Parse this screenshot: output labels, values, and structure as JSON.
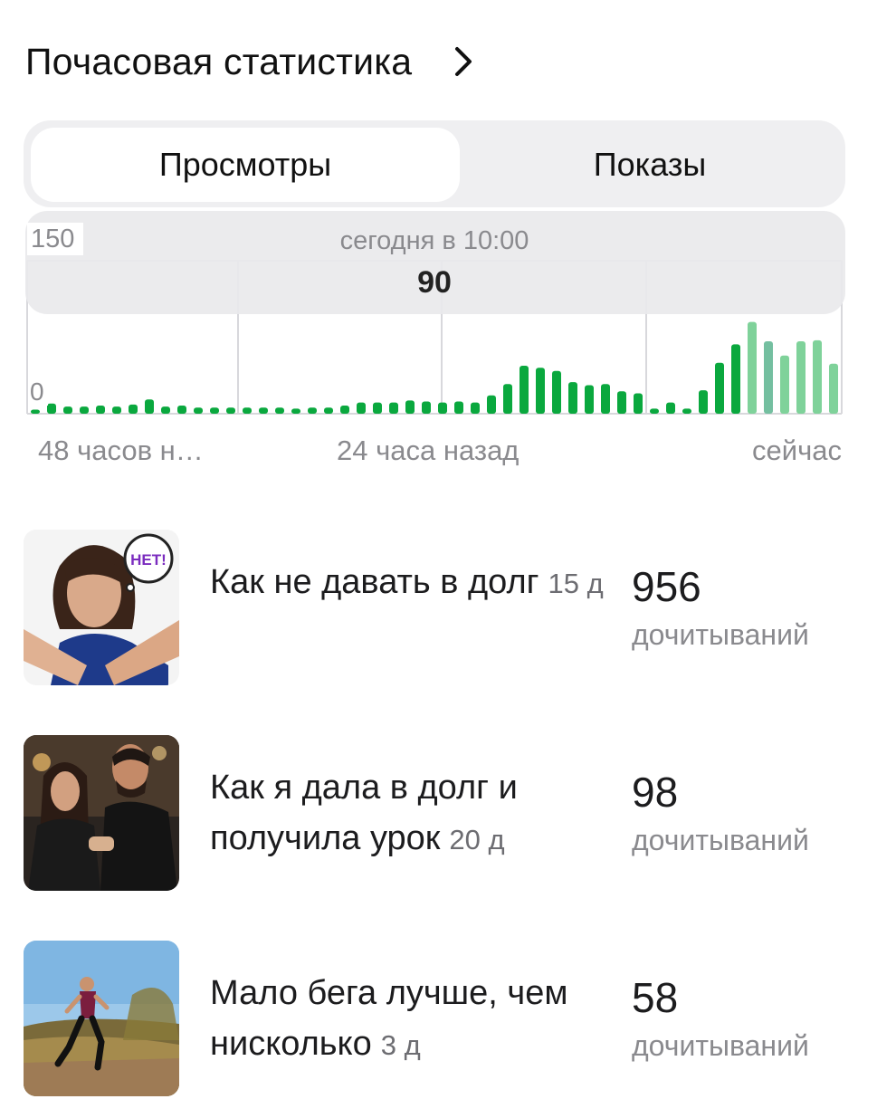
{
  "header": {
    "title": "Почасовая статистика"
  },
  "tabs": [
    {
      "label": "Просмотры",
      "active": true
    },
    {
      "label": "Показы",
      "active": false
    }
  ],
  "chart_data": {
    "type": "bar",
    "ymax_label": "150",
    "ymin_label": "0",
    "ylim": [
      0,
      150
    ],
    "tooltip": {
      "time": "сегодня в 10:00",
      "value": "90"
    },
    "x_labels": [
      "48 часов н…",
      "24 часа назад",
      "сейчас"
    ],
    "values": [
      4,
      10,
      7,
      7,
      8,
      7,
      9,
      14,
      7,
      8,
      6,
      6,
      6,
      6,
      6,
      6,
      5,
      6,
      6,
      8,
      11,
      11,
      11,
      13,
      12,
      11,
      12,
      11,
      18,
      29,
      47,
      45,
      42,
      31,
      28,
      29,
      22,
      20,
      5,
      11,
      5,
      23,
      50,
      68,
      90,
      71,
      57,
      71,
      72,
      49
    ],
    "colors": {
      "primary": "#0aa83e",
      "light": "#7fd29a",
      "teal": "#74bfa0",
      "grid": "#d8d8dc"
    }
  },
  "articles": [
    {
      "title": "Как не давать в долг",
      "age": "15 д",
      "count": "956",
      "unit": "дочитываний",
      "badge": "НЕТ!"
    },
    {
      "title": "Как я дала в долг и получила урок",
      "age": "20 д",
      "count": "98",
      "unit": "дочитываний"
    },
    {
      "title": "Мало бега лучше, чем нисколько",
      "age": "3 д",
      "count": "58",
      "unit": "дочитываний"
    }
  ]
}
